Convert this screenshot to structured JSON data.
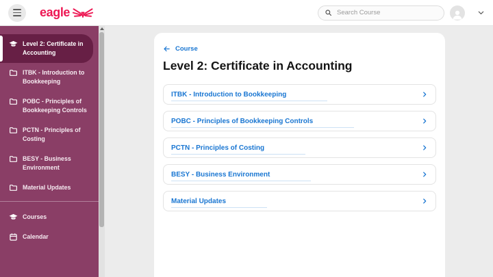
{
  "header": {
    "logo_text": "eagle",
    "search_placeholder": "Search Course"
  },
  "sidebar": {
    "active_item": {
      "label": "Level 2: Certificate in Accounting",
      "icon": "graduation-cap-icon"
    },
    "module_items": [
      {
        "label": "ITBK - Introduction to Bookkeeping",
        "icon": "folder-icon"
      },
      {
        "label": "POBC - Principles of Bookkeeping Controls",
        "icon": "folder-icon"
      },
      {
        "label": "PCTN - Principles of Costing",
        "icon": "folder-icon"
      },
      {
        "label": "BESY - Business Environment",
        "icon": "folder-icon"
      },
      {
        "label": "Material Updates",
        "icon": "folder-icon"
      }
    ],
    "nav_items": [
      {
        "label": "Courses",
        "icon": "graduation-cap-icon"
      },
      {
        "label": "Calendar",
        "icon": "calendar-icon"
      }
    ]
  },
  "main": {
    "back_link_label": "Course",
    "title": "Level 2: Certificate in Accounting",
    "course_links": [
      "ITBK - Introduction to Bookkeeping",
      "POBC - Principles of Bookkeeping Controls",
      "PCTN - Principles of Costing",
      "BESY - Business Environment",
      "Material Updates"
    ]
  },
  "icons": {
    "hamburger-icon": "menu",
    "eagle-wings-icon": "brand mark",
    "search-icon": "magnifier",
    "avatar-icon": "person",
    "chevron-down-icon": "expand",
    "graduation-cap-icon": "courses",
    "folder-icon": "module",
    "calendar-icon": "calendar",
    "back-arrow-icon": "back",
    "chevron-right-icon": "open"
  },
  "colors": {
    "brand_pink": "#ed1753",
    "sidebar_bg": "#8a3e66",
    "sidebar_active_bg": "#671f45",
    "link_blue": "#1976d2",
    "main_bg": "#ececec"
  }
}
